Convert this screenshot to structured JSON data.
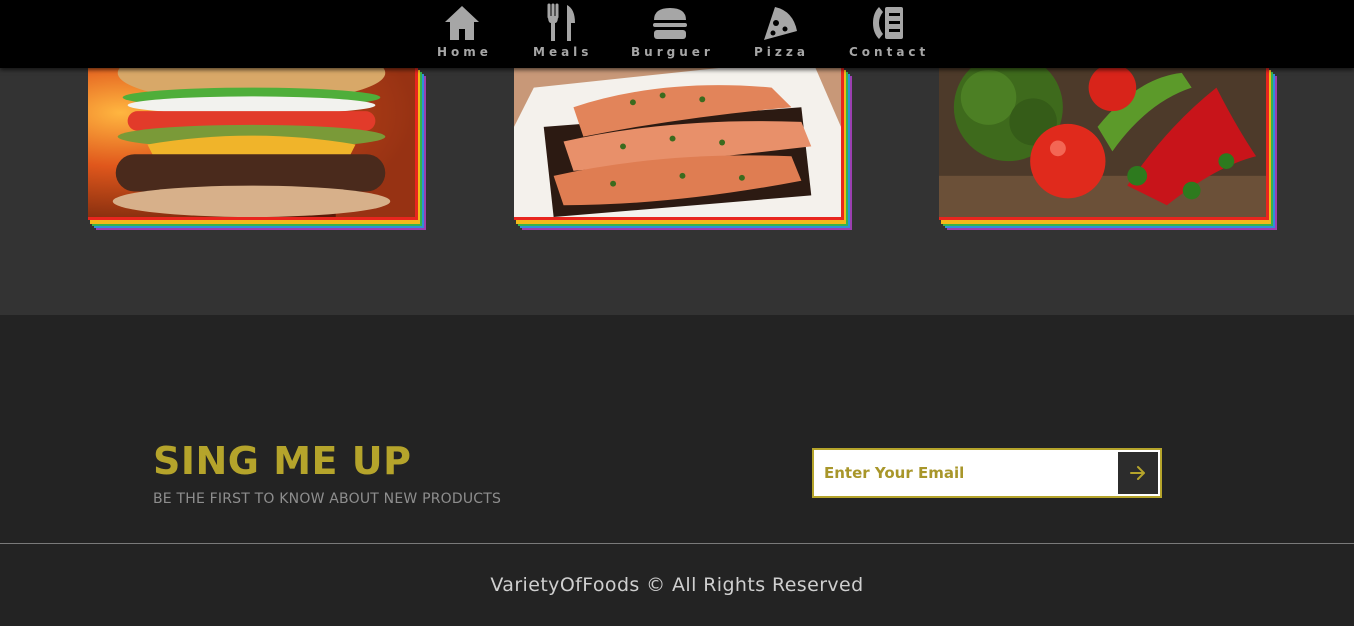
{
  "nav": {
    "items": [
      {
        "label": "Home",
        "icon": "home-icon"
      },
      {
        "label": "Meals",
        "icon": "fork-knife-icon"
      },
      {
        "label": "Burguer",
        "icon": "burger-icon"
      },
      {
        "label": "Pizza",
        "icon": "pizza-slice-icon"
      },
      {
        "label": "Contact",
        "icon": "phone-book-icon"
      }
    ]
  },
  "gallery": {
    "cards": [
      {
        "subject": "burger-photo"
      },
      {
        "subject": "salmon-photo"
      },
      {
        "subject": "vegetables-photo"
      }
    ],
    "frame_colors": [
      "#e8261e",
      "#f4b81a",
      "#37b44a",
      "#2f8fd8",
      "#9b3fb0"
    ]
  },
  "signup": {
    "title": "SING ME UP",
    "subtitle": "BE THE FIRST TO KNOW ABOUT NEW PRODUCTS",
    "email_placeholder": "Enter Your Email",
    "submit_icon": "arrow-right-icon"
  },
  "footer": {
    "copyright": "VarietyOfFoods © All Rights Reserved"
  },
  "colors": {
    "accent": "#b5a42b",
    "nav_bg": "#000000",
    "section_bg": "#333333",
    "footer_bg": "#232323",
    "nav_text": "#a6a6a6"
  }
}
